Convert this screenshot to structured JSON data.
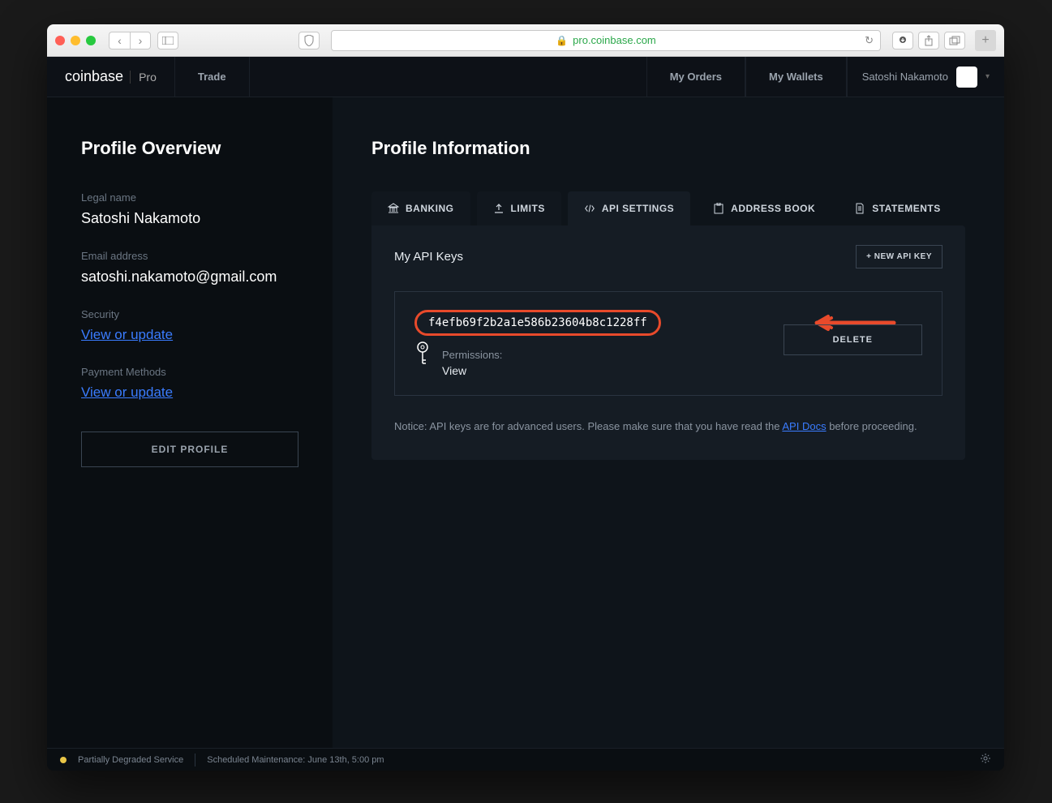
{
  "browser": {
    "url": "pro.coinbase.com"
  },
  "header": {
    "brand": "coinbase",
    "brand_suffix": "Pro",
    "nav_trade": "Trade",
    "nav_orders": "My Orders",
    "nav_wallets": "My Wallets",
    "user_name": "Satoshi Nakamoto"
  },
  "sidebar": {
    "title": "Profile Overview",
    "legal_name_label": "Legal name",
    "legal_name_value": "Satoshi Nakamoto",
    "email_label": "Email address",
    "email_value": "satoshi.nakamoto@gmail.com",
    "security_label": "Security",
    "security_link": "View or update",
    "payment_label": "Payment Methods",
    "payment_link": "View or update",
    "edit_button": "EDIT PROFILE"
  },
  "main": {
    "title": "Profile Information",
    "tabs": {
      "banking": "BANKING",
      "limits": "LIMITS",
      "api": "API SETTINGS",
      "address": "ADDRESS BOOK",
      "statements": "STATEMENTS"
    },
    "panel_title": "My API Keys",
    "new_key_button": "+ NEW API KEY",
    "api_key": "f4efb69f2b2a1e586b23604b8c1228ff",
    "permissions_label": "Permissions:",
    "permissions_value": "View",
    "delete_button": "DELETE",
    "notice_prefix": "Notice: API keys are for advanced users. Please make sure that you have read the ",
    "notice_link": "API Docs",
    "notice_suffix": " before proceeding."
  },
  "status": {
    "service": "Partially Degraded Service",
    "maintenance": "Scheduled Maintenance: June 13th, 5:00 pm"
  }
}
